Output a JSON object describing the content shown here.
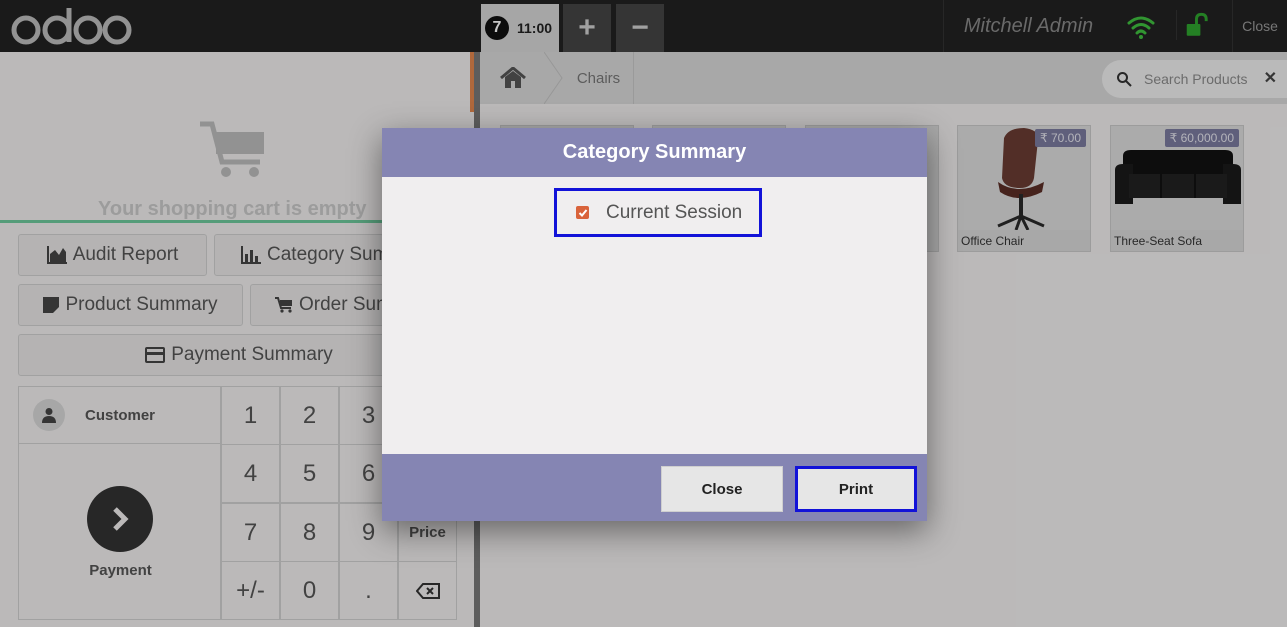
{
  "topbar": {
    "order_number": "7",
    "order_time": "11:00",
    "add_order": "+",
    "remove_order": "−",
    "username": "Mitchell Admin",
    "close_label": "Close"
  },
  "cart": {
    "empty_text": "Your shopping cart is empty"
  },
  "controls": {
    "audit_report": "Audit Report",
    "category_summary": "Category Sum",
    "product_summary": "Product Summary",
    "order_summary": "Order Sum",
    "payment_summary": "Payment Summary"
  },
  "numpad": {
    "customer_label": "Customer",
    "payment_label": "Payment",
    "keys": [
      "1",
      "2",
      "3",
      "4",
      "5",
      "6",
      "7",
      "8",
      "9",
      "+/-",
      "0",
      "."
    ],
    "price_label": "Price"
  },
  "breadcrumb": {
    "category": "Chairs"
  },
  "search": {
    "placeholder": "Search Products"
  },
  "products": [
    {
      "name": "Office Chair",
      "price": "₹ 70.00"
    },
    {
      "name": "Three-Seat Sofa",
      "price": "₹ 60,000.00"
    }
  ],
  "modal": {
    "title": "Category Summary",
    "option_label": "Current Session",
    "option_checked": true,
    "close_button": "Close",
    "print_button": "Print"
  },
  "colors": {
    "modal_header": "#8585b3",
    "highlight_border": "#1212d8",
    "checkbox": "#d9633b",
    "wifi": "#3fbf3f"
  }
}
